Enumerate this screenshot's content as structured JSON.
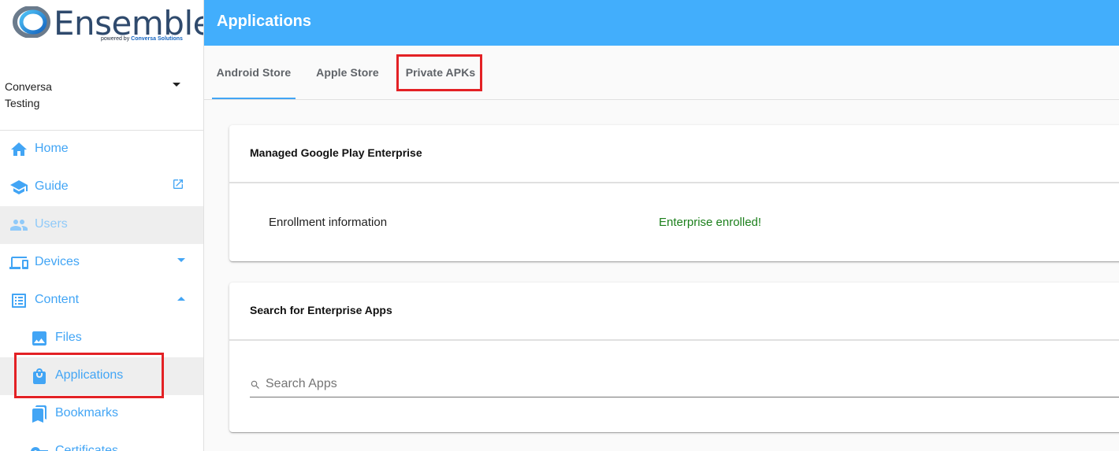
{
  "brand": {
    "name": "Ensemble",
    "powered_prefix": "powered by",
    "powered_company": "Conversa Solutions"
  },
  "org": {
    "line1": "Conversa",
    "line2": "Testing"
  },
  "sidebar": {
    "items": [
      {
        "label": "Home"
      },
      {
        "label": "Guide"
      },
      {
        "label": "Users"
      },
      {
        "label": "Devices"
      },
      {
        "label": "Content"
      },
      {
        "label": "Files"
      },
      {
        "label": "Applications"
      },
      {
        "label": "Bookmarks"
      },
      {
        "label": "Certificates"
      }
    ]
  },
  "header": {
    "title": "Applications"
  },
  "tabs": [
    {
      "label": "Android Store"
    },
    {
      "label": "Apple Store"
    },
    {
      "label": "Private APKs"
    }
  ],
  "enterprise_card": {
    "title": "Managed Google Play Enterprise",
    "enrollment_label": "Enrollment information",
    "enrollment_status": "Enterprise enrolled!"
  },
  "search_card": {
    "title": "Search for Enterprise Apps",
    "placeholder": "Search Apps"
  },
  "colors": {
    "accent": "#42a5f5",
    "header": "#42aefc",
    "highlight": "#e32125",
    "success": "#1b7f1b"
  }
}
